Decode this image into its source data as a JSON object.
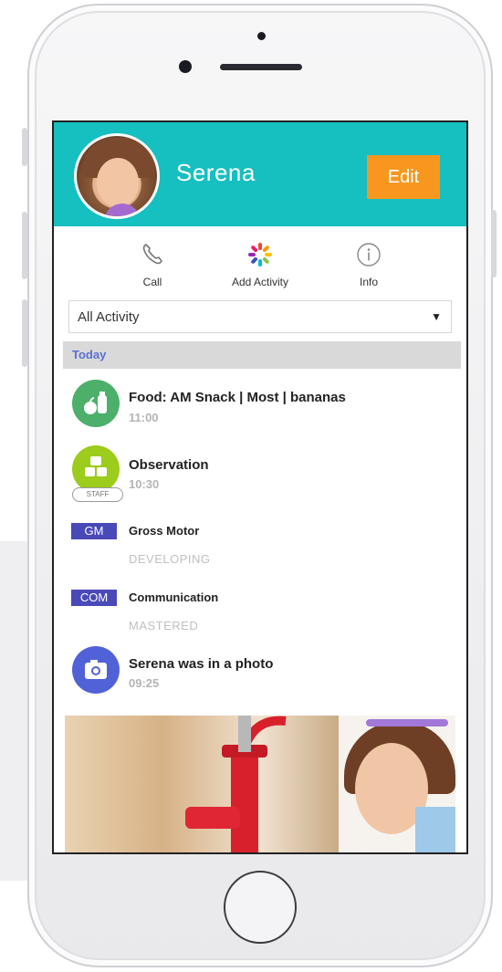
{
  "profile": {
    "name": "Serena",
    "edit_label": "Edit"
  },
  "actions": [
    {
      "label": "Call",
      "icon": "phone-icon"
    },
    {
      "label": "Add Activity",
      "icon": "add-activity-icon"
    },
    {
      "label": "Info",
      "icon": "info-icon"
    }
  ],
  "filter": {
    "selected": "All Activity"
  },
  "section": {
    "label": "Today"
  },
  "feed": {
    "food": {
      "title": "Food: AM Snack | Most | bananas",
      "time": "11:00",
      "icon": "food-icon"
    },
    "observation": {
      "title": "Observation",
      "time": "10:30",
      "badge": "STAFF",
      "icon": "observation-icon"
    },
    "skills": [
      {
        "tag": "GM",
        "label": "Gross Motor",
        "status": "DEVELOPING"
      },
      {
        "tag": "COM",
        "label": "Communication",
        "status": "MASTERED"
      }
    ],
    "photo": {
      "title": "Serena was in a photo",
      "time": "09:25",
      "icon": "camera-icon"
    }
  },
  "colors": {
    "header": "#16bfc0",
    "edit_button": "#f7971e",
    "tag": "#4a49b8",
    "food_icon": "#4caf6a",
    "observation_icon": "#9ccc1c",
    "camera_icon": "#5161d8"
  }
}
